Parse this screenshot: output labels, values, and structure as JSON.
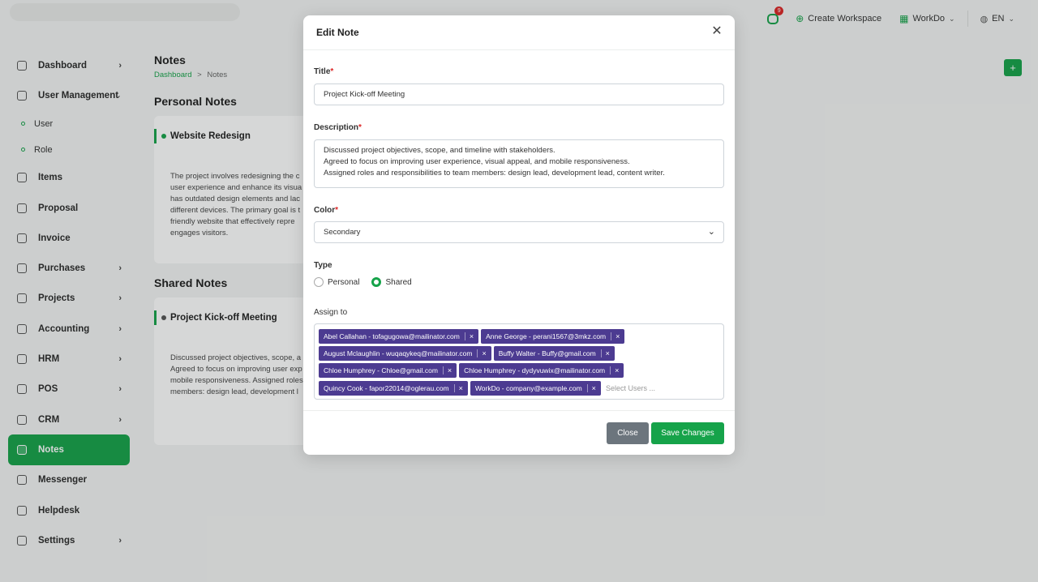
{
  "topbar": {
    "notification_count": "9",
    "create_workspace": "Create Workspace",
    "workspace": "WorkDo",
    "language": "EN"
  },
  "sidebar": {
    "items": [
      {
        "label": "Dashboard",
        "has_arrow": true
      },
      {
        "label": "User Management",
        "expanded": true
      },
      {
        "label": "User",
        "sub": true
      },
      {
        "label": "Role",
        "sub": true
      },
      {
        "label": "Items"
      },
      {
        "label": "Proposal"
      },
      {
        "label": "Invoice"
      },
      {
        "label": "Purchases",
        "has_arrow": true
      },
      {
        "label": "Projects",
        "has_arrow": true
      },
      {
        "label": "Accounting",
        "has_arrow": true
      },
      {
        "label": "HRM",
        "has_arrow": true
      },
      {
        "label": "POS",
        "has_arrow": true
      },
      {
        "label": "CRM",
        "has_arrow": true
      },
      {
        "label": "Notes",
        "active": true
      },
      {
        "label": "Messenger"
      },
      {
        "label": "Helpdesk"
      },
      {
        "label": "Settings",
        "has_arrow": true
      }
    ]
  },
  "main": {
    "title": "Notes",
    "breadcrumb": {
      "home": "Dashboard",
      "sep": ">",
      "current": "Notes"
    },
    "add_label": "+",
    "personal_heading": "Personal Notes",
    "shared_heading": "Shared Notes",
    "personal_card": {
      "title": "Website Redesign",
      "body": "The project involves redesigning the c user experience and enhance its visua has outdated design elements and lac different devices. The primary goal is t friendly website that effectively repre engages visitors."
    },
    "shared_card": {
      "title": "Project Kick-off Meeting",
      "body": "Discussed project objectives, scope, a Agreed to focus on improving user exp mobile responsiveness. Assigned roles members: design lead, development l"
    }
  },
  "modal": {
    "title": "Edit Note",
    "close_glyph": "✕",
    "title_label": "Title",
    "title_value": "Project Kick-off Meeting",
    "description_label": "Description",
    "description_lines": [
      "Discussed project objectives, scope, and timeline with stakeholders.",
      "Agreed to focus on improving user experience, visual appeal, and mobile responsiveness.",
      "Assigned roles and responsibilities to team members: design lead, development lead, content writer."
    ],
    "color_label": "Color",
    "color_value": "Secondary",
    "type_label": "Type",
    "type_options": [
      {
        "label": "Personal",
        "checked": false
      },
      {
        "label": "Shared",
        "checked": true
      }
    ],
    "assign_label": "Assign to",
    "assign_placeholder": "Select Users ...",
    "assigned_users": [
      "Abel Callahan - tofagugowa@mailinator.com",
      "Anne George - perani1567@3mkz.com",
      "August Mclaughlin - wuqaqykeq@mailinator.com",
      "Buffy Walter - Buffy@gmail.com",
      "Chloe Humphrey - Chloe@gmail.com",
      "Chloe Humphrey - dydyvuwix@mailinator.com",
      "Quincy Cook - fapor22014@oglerau.com",
      "WorkDo - company@example.com"
    ],
    "close_button": "Close",
    "save_button": "Save Changes",
    "required_mark": "*"
  },
  "colors": {
    "accent": "#16a34a",
    "tag": "#4c3b91",
    "close_btn": "#6c757d",
    "required": "#dc2626"
  }
}
